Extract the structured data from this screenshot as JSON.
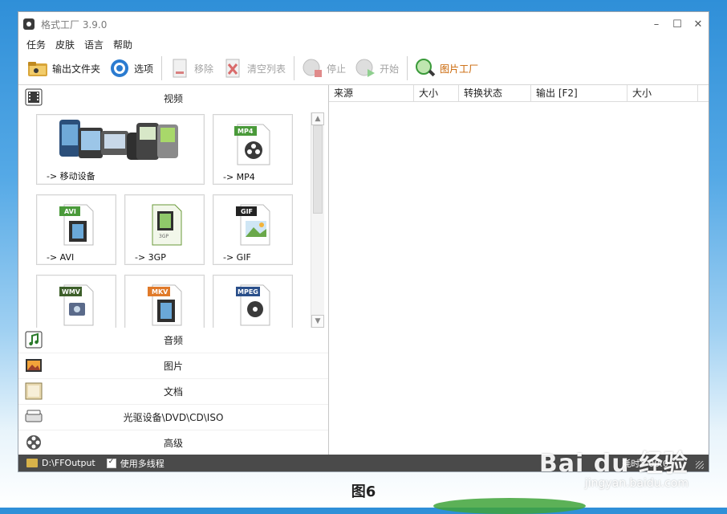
{
  "window": {
    "title": "格式工厂 3.9.0"
  },
  "window_controls": {
    "minimize": "–",
    "maximize": "☐",
    "close": "✕"
  },
  "menu": [
    "任务",
    "皮肤",
    "语言",
    "帮助"
  ],
  "toolbar": {
    "output_folder": "输出文件夹",
    "options": "选项",
    "remove": "移除",
    "clear_list": "清空列表",
    "stop": "停止",
    "start": "开始",
    "picture_factory": "图片工厂"
  },
  "categories": {
    "video": "视频",
    "audio": "音频",
    "picture": "图片",
    "document": "文档",
    "rom": "光驱设备\\DVD\\CD\\ISO",
    "advanced": "高级"
  },
  "video_tiles": [
    {
      "label": "-> 移动设备",
      "icon": "mobile-devices-icon"
    },
    {
      "label": "-> MP4",
      "badge": "MP4",
      "badge_color": "#4a9a3a"
    },
    {
      "label": "-> AVI",
      "badge": "AVI",
      "badge_color": "#4a9a3a"
    },
    {
      "label": "-> 3GP",
      "badge": "3GP",
      "badge_color": "#4a9a3a"
    },
    {
      "label": "-> GIF",
      "badge": "GIF",
      "badge_color": "#222222"
    },
    {
      "label": "",
      "badge": "WMV",
      "badge_color": "#3d5f2a"
    },
    {
      "label": "",
      "badge": "MKV",
      "badge_color": "#e07a2a"
    },
    {
      "label": "",
      "badge": "MPEG",
      "badge_color": "#2a4f8a"
    }
  ],
  "task_table": {
    "columns": [
      "来源",
      "大小",
      "转换状态",
      "输出 [F2]",
      "大小"
    ]
  },
  "status": {
    "output_path": "D:\\FFOutput",
    "multithread": "使用多线程",
    "elapsed": "耗时：00:0"
  },
  "watermark": {
    "brand": "Bai du 经验",
    "url": "jingyan.baidu.com"
  },
  "caption": "图6"
}
